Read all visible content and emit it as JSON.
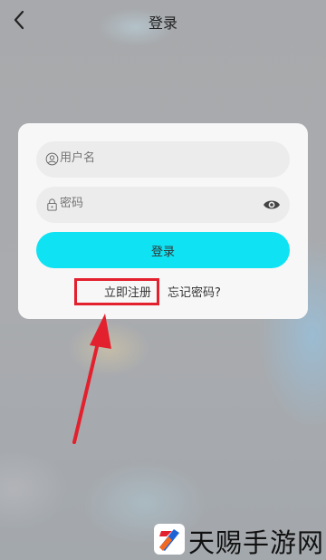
{
  "header": {
    "title": "登录",
    "back_icon": "chevron-left-icon"
  },
  "form": {
    "username_placeholder": "用户名",
    "password_placeholder": "密码",
    "user_icon": "user-circle-icon",
    "lock_icon": "lock-icon",
    "eye_icon": "eye-icon",
    "login_label": "登录",
    "button_color": "#0fe3f3"
  },
  "links": {
    "register": "立即注册",
    "forgot": "忘记密码?"
  },
  "annotation": {
    "highlight_color": "#e3202d"
  },
  "watermark": {
    "text": "天赐手游网"
  }
}
